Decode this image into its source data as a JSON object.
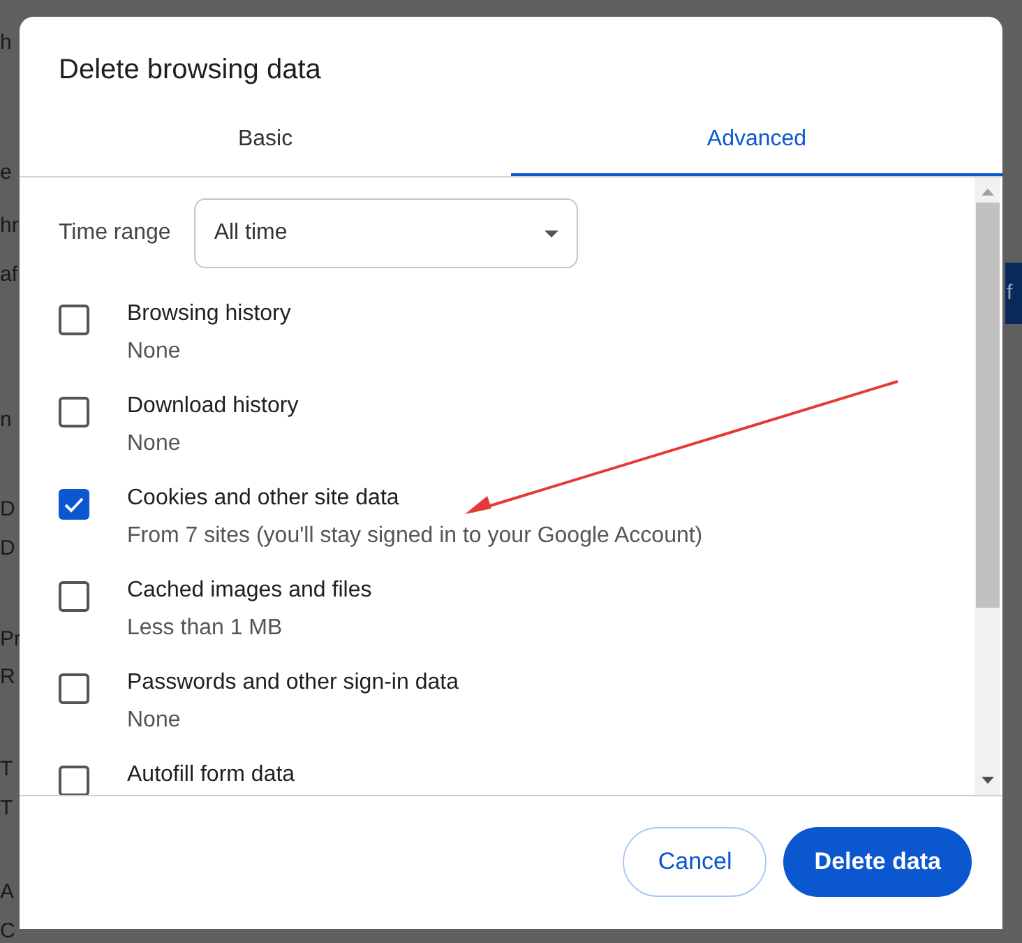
{
  "background": {
    "left_fragments": [
      "h",
      "e",
      "hr",
      "af",
      "n",
      "D",
      "D",
      "Pr",
      "R",
      "T",
      "T",
      "A",
      "C"
    ],
    "right_button": "f"
  },
  "dialog": {
    "title": "Delete browsing data",
    "tabs": [
      {
        "label": "Basic",
        "selected": false
      },
      {
        "label": "Advanced",
        "selected": true
      }
    ],
    "time_range": {
      "label": "Time range",
      "value": "All time"
    },
    "items": [
      {
        "label": "Browsing history",
        "detail": "None",
        "checked": false
      },
      {
        "label": "Download history",
        "detail": "None",
        "checked": false
      },
      {
        "label": "Cookies and other site data",
        "detail": "From 7 sites (you'll stay signed in to your Google Account)",
        "checked": true
      },
      {
        "label": "Cached images and files",
        "detail": "Less than 1 MB",
        "checked": false
      },
      {
        "label": "Passwords and other sign-in data",
        "detail": "None",
        "checked": false
      },
      {
        "label": "Autofill form data",
        "checked": false
      }
    ],
    "buttons": {
      "cancel": "Cancel",
      "confirm": "Delete data"
    }
  }
}
